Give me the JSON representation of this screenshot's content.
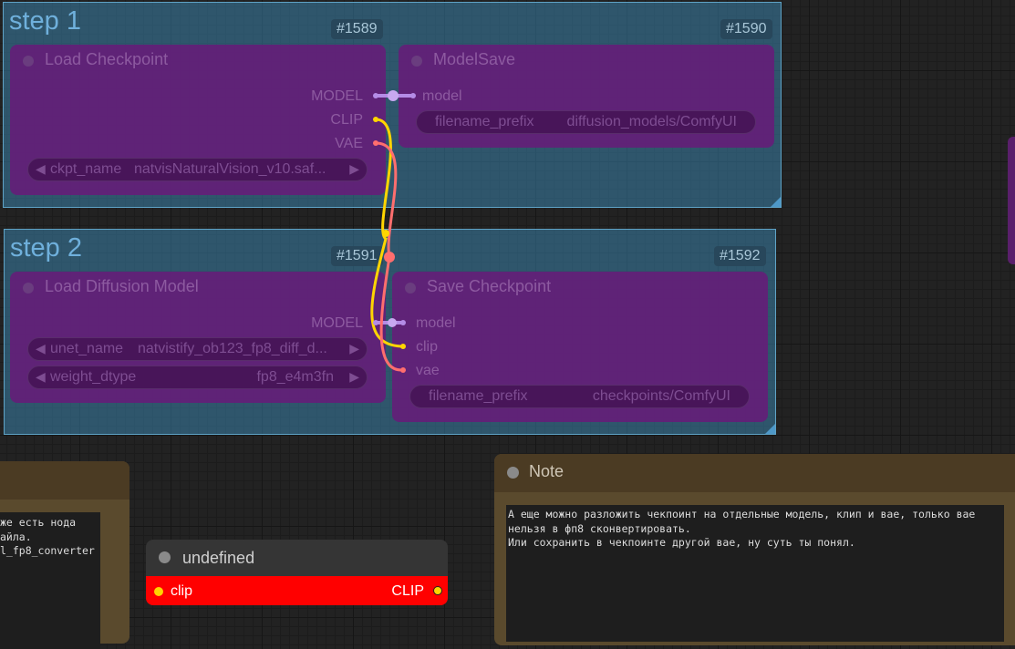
{
  "groups": {
    "step1": {
      "title": "step 1"
    },
    "step2": {
      "title": "step 2"
    }
  },
  "node_ids": {
    "n1589": "#1589",
    "n1590": "#1590",
    "n1591": "#1591",
    "n1592": "#1592"
  },
  "load_checkpoint": {
    "title": "Load Checkpoint",
    "outputs": {
      "model": "MODEL",
      "clip": "CLIP",
      "vae": "VAE"
    },
    "ckpt_name_label": "ckpt_name",
    "ckpt_name_value": "natvisNaturalVision_v10.saf..."
  },
  "model_save": {
    "title": "ModelSave",
    "input_model": "model",
    "filename_prefix_label": "filename_prefix",
    "filename_prefix_value": "diffusion_models/ComfyUI"
  },
  "load_diffusion_model": {
    "title": "Load Diffusion Model",
    "output_model": "MODEL",
    "unet_name_label": "unet_name",
    "unet_name_value": "natvistify_ob123_fp8_diff_d...",
    "weight_dtype_label": "weight_dtype",
    "weight_dtype_value": "fp8_e4m3fn"
  },
  "save_checkpoint": {
    "title": "Save Checkpoint",
    "inputs": {
      "model": "model",
      "clip": "clip",
      "vae": "vae"
    },
    "filename_prefix_label": "filename_prefix",
    "filename_prefix_value": "checkpoints/ComfyUI"
  },
  "note_left": {
    "text": "же есть нода\nайла.\nl_fp8_converter"
  },
  "undefined_node": {
    "title": "undefined",
    "input_label": "clip",
    "output_label": "CLIP"
  },
  "note_right": {
    "title": "Note",
    "text": "А еще можно разложить чекпоинт на отдельные модель, клип и вае, только вае\nнельзя в фп8 сконвертировать.\nИли сохранить в чекпоинте другой вае, ну суть ты понял."
  },
  "colors": {
    "group_fill": "#3a82aa",
    "node_fill": "#641e78",
    "model_link": "#b48ce6",
    "clip_link": "#ffd500",
    "vae_link": "#ff6e6e",
    "error_node": "#ff0000"
  }
}
